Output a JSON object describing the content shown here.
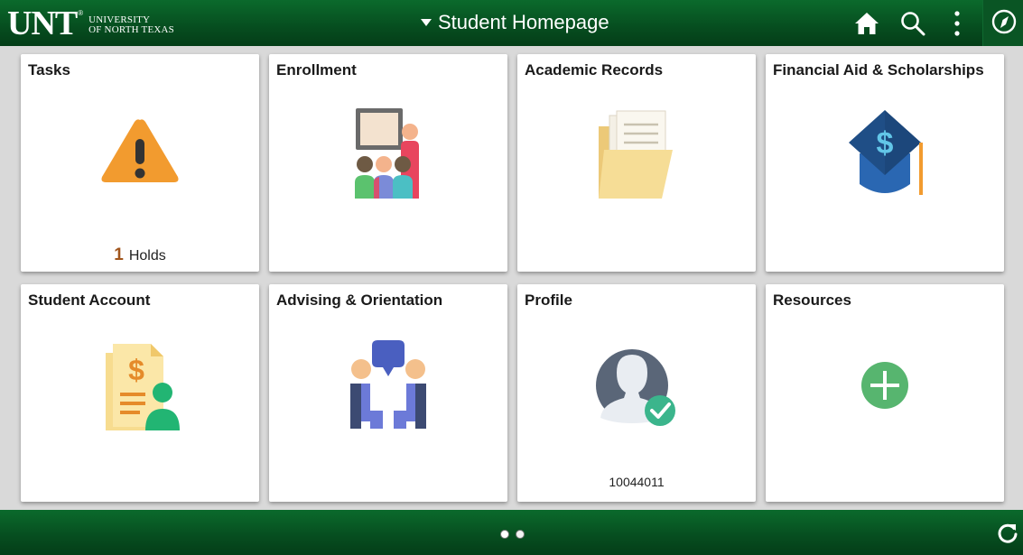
{
  "header": {
    "logo_text": "UNT",
    "logo_subtitle_line1": "University",
    "logo_subtitle_line2": "of North Texas",
    "logo_tm": "®",
    "title": "Student Homepage",
    "icons": [
      "home-icon",
      "search-icon",
      "more-vertical-icon",
      "navbar-compass-icon"
    ]
  },
  "tiles": [
    {
      "title": "Tasks",
      "icon": "warning-icon",
      "count_value": "1",
      "count_label": "Holds"
    },
    {
      "title": "Enrollment",
      "icon": "classroom-icon"
    },
    {
      "title": "Academic Records",
      "icon": "folder-icon"
    },
    {
      "title": "Financial Aid & Scholarships",
      "icon": "graduation-cap-dollar-icon"
    },
    {
      "title": "Student Account",
      "icon": "account-document-icon"
    },
    {
      "title": "Advising & Orientation",
      "icon": "advising-conversation-icon"
    },
    {
      "title": "Profile",
      "icon": "profile-check-icon",
      "footer_text": "10044011"
    },
    {
      "title": "Resources",
      "icon": "add-circle-icon"
    }
  ],
  "footer": {
    "pages": 2,
    "active_page": 1,
    "icons": [
      "refresh-icon"
    ]
  },
  "colors": {
    "header_green": "#064d1f",
    "background": "#d9d9d9",
    "holds_count": "#a0551c"
  }
}
